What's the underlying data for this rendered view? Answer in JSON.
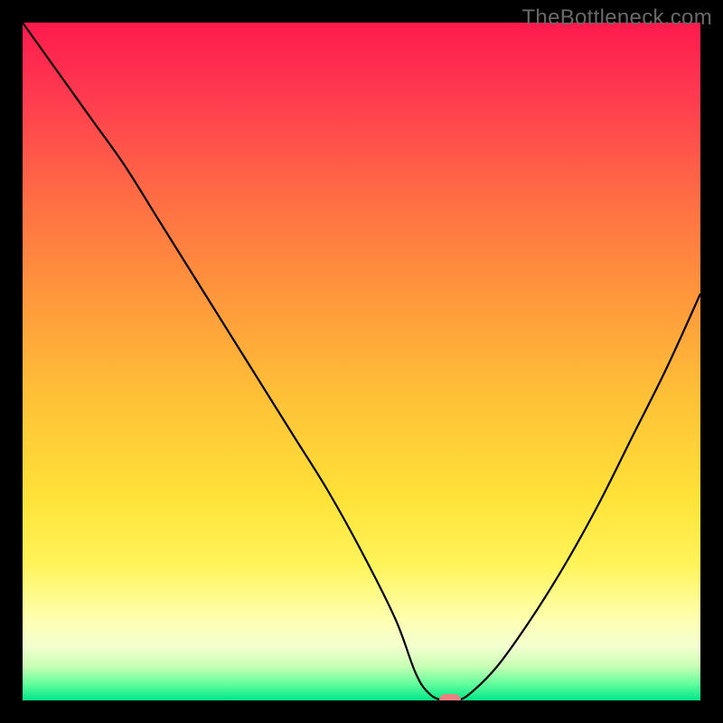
{
  "watermark": "TheBottleneck.com",
  "colors": {
    "frame": "#000000",
    "curve": "#000000",
    "marker": "#f08080",
    "gradient_stops": [
      {
        "offset": 0.0,
        "color": "#ff1a4d"
      },
      {
        "offset": 0.1,
        "color": "#ff3850"
      },
      {
        "offset": 0.25,
        "color": "#ff6a45"
      },
      {
        "offset": 0.4,
        "color": "#ff963c"
      },
      {
        "offset": 0.55,
        "color": "#ffc037"
      },
      {
        "offset": 0.7,
        "color": "#ffe238"
      },
      {
        "offset": 0.8,
        "color": "#fff45a"
      },
      {
        "offset": 0.88,
        "color": "#feffb0"
      },
      {
        "offset": 0.92,
        "color": "#f4ffd0"
      },
      {
        "offset": 0.95,
        "color": "#c7ffb5"
      },
      {
        "offset": 0.975,
        "color": "#66ff9d"
      },
      {
        "offset": 1.0,
        "color": "#00e688"
      }
    ]
  },
  "chart_data": {
    "type": "line",
    "title": "",
    "xlabel": "",
    "ylabel": "",
    "xlim": [
      0,
      100
    ],
    "ylim": [
      0,
      100
    ],
    "grid": false,
    "legend": false,
    "annotations": [
      "TheBottleneck.com"
    ],
    "marker": {
      "x": 63,
      "y": 0
    },
    "series": [
      {
        "name": "bottleneck-curve",
        "x": [
          0,
          5,
          10,
          15,
          20,
          25,
          30,
          35,
          40,
          45,
          50,
          55,
          58,
          60,
          62,
          64,
          66,
          70,
          75,
          80,
          85,
          90,
          95,
          100
        ],
        "y": [
          100,
          93,
          86,
          79,
          71,
          63,
          55,
          47,
          39,
          31,
          22,
          12,
          4,
          1,
          0,
          0,
          1,
          5,
          12,
          20,
          29,
          39,
          49,
          60
        ]
      }
    ]
  }
}
